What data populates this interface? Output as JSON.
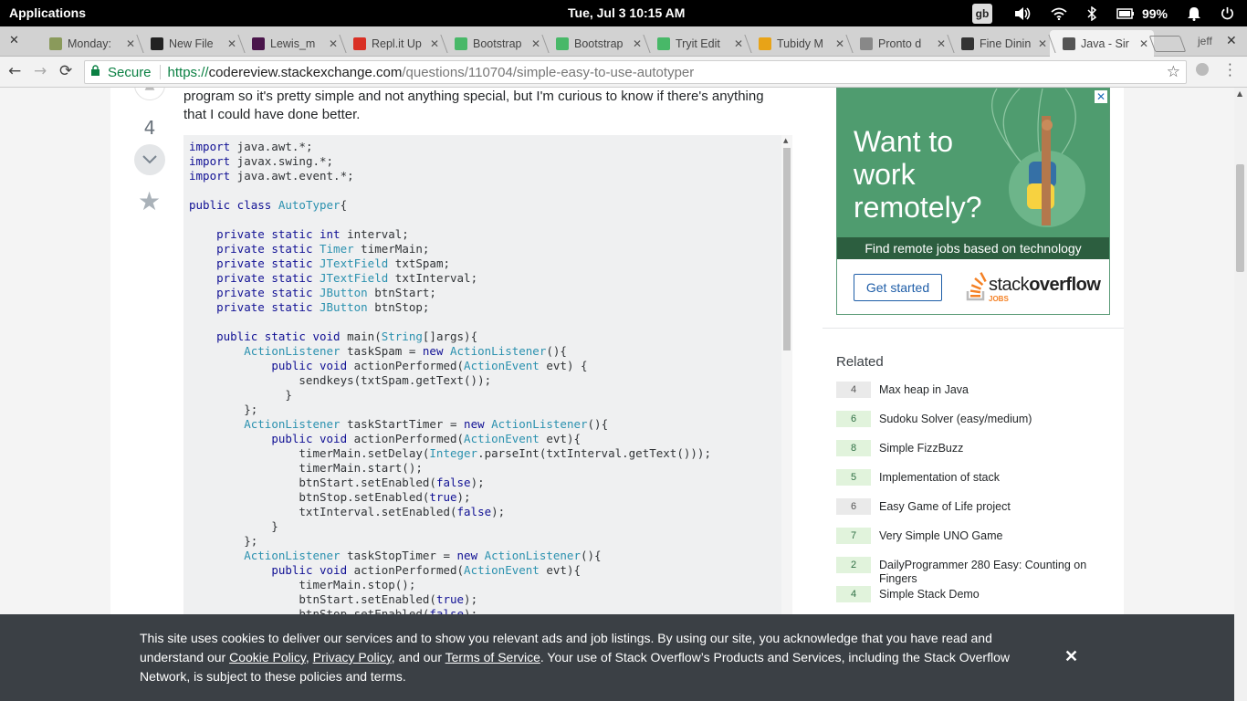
{
  "system": {
    "apps": "Applications",
    "clock": "Tue, Jul 3 10:15 AM",
    "input_source": "gb",
    "battery": "99%"
  },
  "tabs": [
    {
      "title": "Monday:",
      "fav_color": "#8a9a5b"
    },
    {
      "title": "New File",
      "fav_color": "#222222"
    },
    {
      "title": "Lewis_m",
      "fav_color": "#4a154b"
    },
    {
      "title": "Repl.it Up",
      "fav_color": "#d93025"
    },
    {
      "title": "Bootstrap",
      "fav_color": "#48b868"
    },
    {
      "title": "Bootstrap",
      "fav_color": "#48b868"
    },
    {
      "title": "Tryit Edit",
      "fav_color": "#48b868"
    },
    {
      "title": "Tubidy M",
      "fav_color": "#e8a317"
    },
    {
      "title": "Pronto d",
      "fav_color": "#888888"
    },
    {
      "title": "Fine Dinin",
      "fav_color": "#333333"
    },
    {
      "title": "Java - Sir",
      "fav_color": "#555555"
    }
  ],
  "profile": "jeff",
  "address": {
    "secure": "Secure",
    "scheme": "https://",
    "host": "codereview.stackexchange.com",
    "path": "/questions/110704/simple-easy-to-use-autotyper"
  },
  "question": {
    "vote_count": "4",
    "text": "program so it's pretty simple and not anything special, but I'm curious to know if there's anything that I could have done better."
  },
  "ad": {
    "headline": "Want to work remotely?",
    "tagline": "Find remote jobs based on technology",
    "button": "Get started",
    "brand_a": "stack",
    "brand_b": "overflow",
    "brand_sub": "JOBS",
    "close": "✕"
  },
  "related": {
    "heading": "Related",
    "items": [
      {
        "score": "4",
        "answered": false,
        "title": "Max heap in Java"
      },
      {
        "score": "6",
        "answered": true,
        "title": "Sudoku Solver (easy/medium)"
      },
      {
        "score": "8",
        "answered": true,
        "title": "Simple FizzBuzz"
      },
      {
        "score": "5",
        "answered": true,
        "title": "Implementation of stack"
      },
      {
        "score": "6",
        "answered": false,
        "title": "Easy Game of Life project"
      },
      {
        "score": "7",
        "answered": true,
        "title": "Very Simple UNO Game"
      },
      {
        "score": "2",
        "answered": true,
        "title": "DailyProgrammer 280 Easy: Counting on Fingers"
      },
      {
        "score": "4",
        "answered": true,
        "title": "Simple Stack Demo"
      }
    ]
  },
  "cookie": {
    "p1": "This site uses cookies to deliver our services and to show you relevant ads and job listings. By using our site, you acknowledge that you have read and understand our ",
    "link1": "Cookie Policy",
    "p2": ", ",
    "link2": "Privacy Policy",
    "p3": ", and our ",
    "link3": "Terms of Service",
    "p4": ". Your use of Stack Overflow’s Products and Services, including the Stack Overflow Network, is subject to these policies and terms.",
    "close": "✕"
  },
  "code_lines": [
    [
      [
        "kw",
        "import"
      ],
      [
        "p",
        " java.awt.*;"
      ]
    ],
    [
      [
        "kw",
        "import"
      ],
      [
        "p",
        " javax.swing.*;"
      ]
    ],
    [
      [
        "kw",
        "import"
      ],
      [
        "p",
        " java.awt.event.*;"
      ]
    ],
    [],
    [
      [
        "kw",
        "public class"
      ],
      [
        "p",
        " "
      ],
      [
        "ty",
        "AutoTyper"
      ],
      [
        "p",
        "{"
      ]
    ],
    [],
    [
      [
        "p",
        "    "
      ],
      [
        "kw",
        "private static int"
      ],
      [
        "p",
        " interval;"
      ]
    ],
    [
      [
        "p",
        "    "
      ],
      [
        "kw",
        "private static"
      ],
      [
        "p",
        " "
      ],
      [
        "ty",
        "Timer"
      ],
      [
        "p",
        " timerMain;"
      ]
    ],
    [
      [
        "p",
        "    "
      ],
      [
        "kw",
        "private static"
      ],
      [
        "p",
        " "
      ],
      [
        "ty",
        "JTextField"
      ],
      [
        "p",
        " txtSpam;"
      ]
    ],
    [
      [
        "p",
        "    "
      ],
      [
        "kw",
        "private static"
      ],
      [
        "p",
        " "
      ],
      [
        "ty",
        "JTextField"
      ],
      [
        "p",
        " txtInterval;"
      ]
    ],
    [
      [
        "p",
        "    "
      ],
      [
        "kw",
        "private static"
      ],
      [
        "p",
        " "
      ],
      [
        "ty",
        "JButton"
      ],
      [
        "p",
        " btnStart;"
      ]
    ],
    [
      [
        "p",
        "    "
      ],
      [
        "kw",
        "private static"
      ],
      [
        "p",
        " "
      ],
      [
        "ty",
        "JButton"
      ],
      [
        "p",
        " btnStop;"
      ]
    ],
    [],
    [
      [
        "p",
        "    "
      ],
      [
        "kw",
        "public static void"
      ],
      [
        "p",
        " main("
      ],
      [
        "ty",
        "String"
      ],
      [
        "p",
        "[]args){"
      ]
    ],
    [
      [
        "p",
        "        "
      ],
      [
        "ty",
        "ActionListener"
      ],
      [
        "p",
        " taskSpam = "
      ],
      [
        "kw",
        "new"
      ],
      [
        "p",
        " "
      ],
      [
        "ty",
        "ActionListener"
      ],
      [
        "p",
        "(){"
      ]
    ],
    [
      [
        "p",
        "            "
      ],
      [
        "kw",
        "public void"
      ],
      [
        "p",
        " actionPerformed("
      ],
      [
        "ty",
        "ActionEvent"
      ],
      [
        "p",
        " evt) {"
      ]
    ],
    [
      [
        "p",
        "                sendkeys(txtSpam.getText());"
      ]
    ],
    [
      [
        "p",
        "              }"
      ]
    ],
    [
      [
        "p",
        "        };"
      ]
    ],
    [
      [
        "p",
        "        "
      ],
      [
        "ty",
        "ActionListener"
      ],
      [
        "p",
        " taskStartTimer = "
      ],
      [
        "kw",
        "new"
      ],
      [
        "p",
        " "
      ],
      [
        "ty",
        "ActionListener"
      ],
      [
        "p",
        "(){"
      ]
    ],
    [
      [
        "p",
        "            "
      ],
      [
        "kw",
        "public void"
      ],
      [
        "p",
        " actionPerformed("
      ],
      [
        "ty",
        "ActionEvent"
      ],
      [
        "p",
        " evt){"
      ]
    ],
    [
      [
        "p",
        "                timerMain.setDelay("
      ],
      [
        "ty",
        "Integer"
      ],
      [
        "p",
        ".parseInt(txtInterval.getText()));"
      ]
    ],
    [
      [
        "p",
        "                timerMain.start();"
      ]
    ],
    [
      [
        "p",
        "                btnStart.setEnabled("
      ],
      [
        "kw",
        "false"
      ],
      [
        "p",
        ");"
      ]
    ],
    [
      [
        "p",
        "                btnStop.setEnabled("
      ],
      [
        "kw",
        "true"
      ],
      [
        "p",
        ");"
      ]
    ],
    [
      [
        "p",
        "                txtInterval.setEnabled("
      ],
      [
        "kw",
        "false"
      ],
      [
        "p",
        ");"
      ]
    ],
    [
      [
        "p",
        "            }"
      ]
    ],
    [
      [
        "p",
        "        };"
      ]
    ],
    [
      [
        "p",
        "        "
      ],
      [
        "ty",
        "ActionListener"
      ],
      [
        "p",
        " taskStopTimer = "
      ],
      [
        "kw",
        "new"
      ],
      [
        "p",
        " "
      ],
      [
        "ty",
        "ActionListener"
      ],
      [
        "p",
        "(){"
      ]
    ],
    [
      [
        "p",
        "            "
      ],
      [
        "kw",
        "public void"
      ],
      [
        "p",
        " actionPerformed("
      ],
      [
        "ty",
        "ActionEvent"
      ],
      [
        "p",
        " evt){"
      ]
    ],
    [
      [
        "p",
        "                timerMain.stop();"
      ]
    ],
    [
      [
        "p",
        "                btnStart.setEnabled("
      ],
      [
        "kw",
        "true"
      ],
      [
        "p",
        ");"
      ]
    ],
    [
      [
        "p",
        "                btnStop.setEnabled("
      ],
      [
        "kw",
        "false"
      ],
      [
        "p",
        ");"
      ]
    ]
  ]
}
